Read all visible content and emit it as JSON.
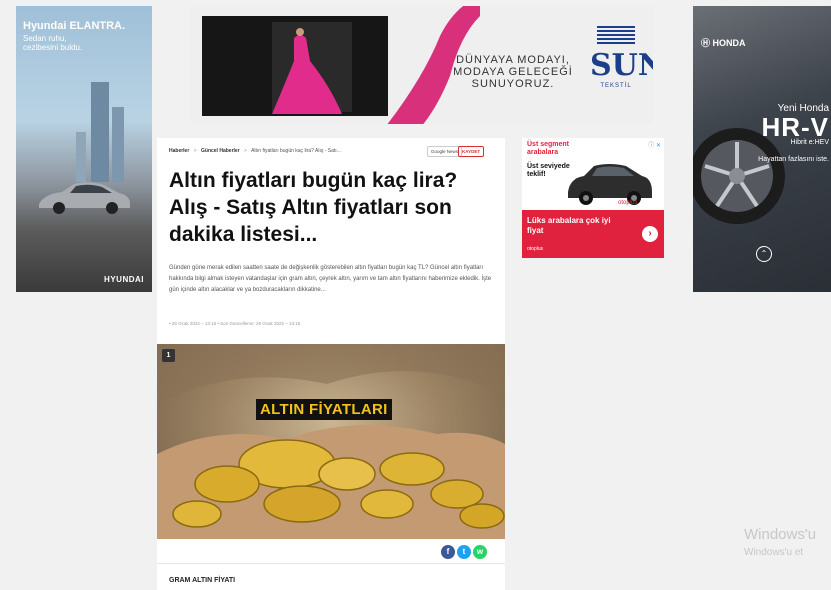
{
  "ads": {
    "left": {
      "brand": "Hyundai ELANTRA.",
      "tagline": "Sedan ruhu, cezibesini buldu.",
      "logo": "HYUNDAI"
    },
    "top": {
      "copy_line1": "DÜNYAYA MODAYI,",
      "copy_line2": "MODAYA GELECEĞİ",
      "copy_line3": "SUNUYORUZ.",
      "brand_word": "SUN",
      "brand_sub": "TEKSTİL"
    },
    "right": {
      "logo": "HONDA",
      "model_prefix": "Yeni Honda",
      "model": "HR-V",
      "hibrit": "Hibrit e:HEV",
      "slogan": "Hayattan fazlasını iste."
    },
    "small": {
      "headline1": "Üst segment arabalara",
      "headline2": "Üst seviyede teklif!",
      "bottom_text": "Lüks arabalara çok iyi fiyat",
      "otoplus1": "otoplus",
      "otoplus2": "otoplus",
      "ad_icons": "ⓘ ✕"
    }
  },
  "article": {
    "breadcrumb": {
      "home": "Haberler",
      "category": "Güncel Haberler",
      "current": "Altın fiyatları bugün kaç lira? Alış - Satı..."
    },
    "google_news_label": "Google News",
    "save_label": "KAYDET",
    "title": "Altın fiyatları bugün kaç lira? Alış - Satış Altın fiyatları son dakika listesi...",
    "lead": "Günden güne merak edilen saatten saate de değişkenlik gösterebilen altın fiyatları bugün kaç TL? Güncel altın fiyatları hakkında bilgi almak isteyen vatandaşlar için gram altın, çeyrek altın, yarım ve tam altın fiyatlarını haberimize ekledik. İşte gün içinde altın alacaklar ve ya bozduracakların dikkatine...",
    "meta": "• 28 Ocak 2022 – 13:16 • Son Güncelleme: 28 Ocak 2022 – 13:16",
    "hero": {
      "badge": "1",
      "caption": "ALTIN FİYATLARI"
    },
    "share": {
      "facebook": "f",
      "twitter": "t",
      "whatsapp": "w"
    },
    "section_heading": "GRAM ALTIN FİYATI"
  },
  "watermark": {
    "line1": "Windows'u",
    "line2": "Windows'u et"
  }
}
